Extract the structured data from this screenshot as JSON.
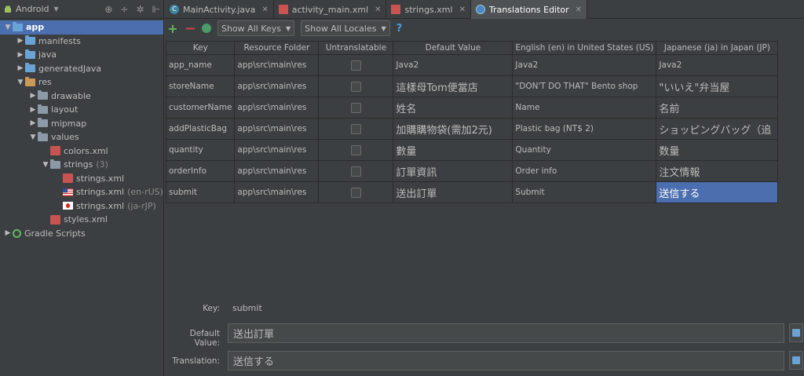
{
  "project": {
    "view_label": "Android",
    "tree": [
      {
        "label": "app",
        "depth": 0,
        "expanded": true,
        "icon": "app-folder",
        "selected": true,
        "bold": true
      },
      {
        "label": "manifests",
        "depth": 1,
        "expanded": false,
        "icon": "folder-blue"
      },
      {
        "label": "java",
        "depth": 1,
        "expanded": false,
        "icon": "folder-blue"
      },
      {
        "label": "generatedJava",
        "depth": 1,
        "expanded": false,
        "icon": "folder-gen"
      },
      {
        "label": "res",
        "depth": 1,
        "expanded": true,
        "icon": "folder-res"
      },
      {
        "label": "drawable",
        "depth": 2,
        "expanded": false,
        "icon": "folder"
      },
      {
        "label": "layout",
        "depth": 2,
        "expanded": false,
        "icon": "folder"
      },
      {
        "label": "mipmap",
        "depth": 2,
        "expanded": false,
        "icon": "folder"
      },
      {
        "label": "values",
        "depth": 2,
        "expanded": true,
        "icon": "folder"
      },
      {
        "label": "colors.xml",
        "depth": 3,
        "leaf": true,
        "icon": "xml-file"
      },
      {
        "label": "strings",
        "depth": 3,
        "expanded": true,
        "icon": "folder",
        "suffix": "(3)"
      },
      {
        "label": "strings.xml",
        "depth": 4,
        "leaf": true,
        "icon": "xml-file"
      },
      {
        "label": "strings.xml",
        "depth": 4,
        "leaf": true,
        "icon": "flag-us",
        "suffix": "(en-rUS)"
      },
      {
        "label": "strings.xml",
        "depth": 4,
        "leaf": true,
        "icon": "flag-jp",
        "suffix": "(ja-rJP)"
      },
      {
        "label": "styles.xml",
        "depth": 3,
        "leaf": true,
        "icon": "xml-file"
      },
      {
        "label": "Gradle Scripts",
        "depth": 0,
        "expanded": false,
        "icon": "gradle-icon"
      }
    ]
  },
  "tabs": [
    {
      "label": "MainActivity.java",
      "icon": "class-icon",
      "active": false
    },
    {
      "label": "activity_main.xml",
      "icon": "xml-icon",
      "active": false
    },
    {
      "label": "strings.xml",
      "icon": "xml-icon",
      "active": false
    },
    {
      "label": "Translations Editor",
      "icon": "globe-icon",
      "active": true
    }
  ],
  "toolbar": {
    "keys_filter": "Show All Keys",
    "locales_filter": "Show All Locales",
    "help": "?"
  },
  "grid": {
    "headers": [
      "Key",
      "Resource Folder",
      "Untranslatable",
      "Default Value",
      "English (en) in United States (US)",
      "Japanese (ja) in Japan (JP)"
    ],
    "rows": [
      {
        "key": "app_name",
        "folder": "app\\src\\main\\res",
        "untranslatable": false,
        "default": "Java2",
        "en": "Java2",
        "ja": "Java2"
      },
      {
        "key": "storeName",
        "folder": "app\\src\\main\\res",
        "untranslatable": false,
        "default": "這樣母Tom便當店",
        "en": "\"DON'T DO THAT\" Bento shop",
        "ja": "\"いいえ\"弁当屋"
      },
      {
        "key": "customerName",
        "folder": "app\\src\\main\\res",
        "untranslatable": false,
        "default": "姓名",
        "en": "Name",
        "ja": "名前"
      },
      {
        "key": "addPlasticBag",
        "folder": "app\\src\\main\\res",
        "untranslatable": false,
        "default": "加購購物袋(需加2元)",
        "en": "Plastic bag (NT$ 2)",
        "ja": "ショッピングバッグ（追"
      },
      {
        "key": "quantity",
        "folder": "app\\src\\main\\res",
        "untranslatable": false,
        "default": "數量",
        "en": "Quantity",
        "ja": "数量"
      },
      {
        "key": "orderInfo",
        "folder": "app\\src\\main\\res",
        "untranslatable": false,
        "default": "訂單資訊",
        "en": "Order info",
        "ja": "注文情報"
      },
      {
        "key": "submit",
        "folder": "app\\src\\main\\res",
        "untranslatable": false,
        "default": "送出訂單",
        "en": "Submit",
        "ja": "送信する"
      }
    ]
  },
  "editor": {
    "key_label": "Key:",
    "key_value": "submit",
    "default_label": "Default Value:",
    "default_value": "送出訂單",
    "translation_label": "Translation:",
    "translation_value": "送信する"
  },
  "colors": {
    "selection": "#4b6eaf",
    "background": "#3c3f41"
  }
}
